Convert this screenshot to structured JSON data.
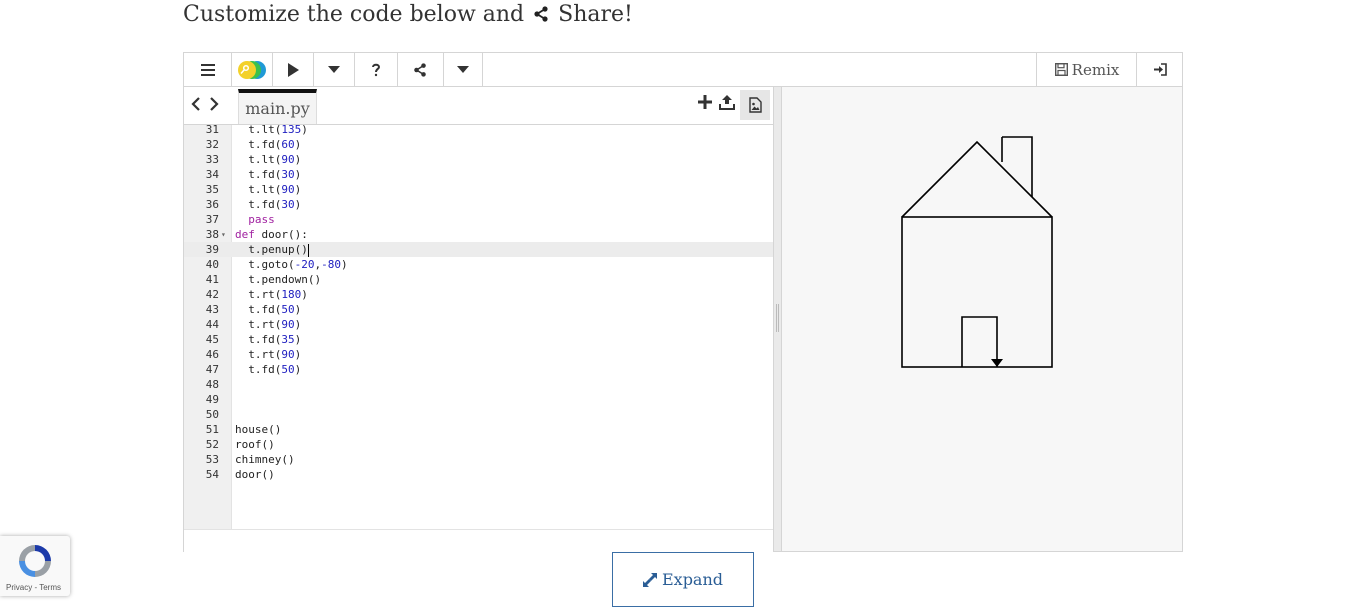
{
  "heading": {
    "prefix": "Customize the code below and",
    "suffix": "Share!"
  },
  "toolbar": {
    "remix_label": "Remix"
  },
  "tabs": [
    {
      "label": "main.py"
    }
  ],
  "code_lines": [
    {
      "n": "31",
      "text": "  t.lt(135)"
    },
    {
      "n": "32",
      "text": "  t.fd(60)"
    },
    {
      "n": "33",
      "text": "  t.lt(90)"
    },
    {
      "n": "34",
      "text": "  t.fd(30)"
    },
    {
      "n": "35",
      "text": "  t.lt(90)"
    },
    {
      "n": "36",
      "text": "  t.fd(30)"
    },
    {
      "n": "37",
      "text": "  pass"
    },
    {
      "n": "38",
      "text": "def door():"
    },
    {
      "n": "39",
      "text": "  t.penup()"
    },
    {
      "n": "40",
      "text": "  t.goto(-20,-80)"
    },
    {
      "n": "41",
      "text": "  t.pendown()"
    },
    {
      "n": "42",
      "text": "  t.rt(180)"
    },
    {
      "n": "43",
      "text": "  t.fd(50)"
    },
    {
      "n": "44",
      "text": "  t.rt(90)"
    },
    {
      "n": "45",
      "text": "  t.fd(35)"
    },
    {
      "n": "46",
      "text": "  t.rt(90)"
    },
    {
      "n": "47",
      "text": "  t.fd(50)"
    },
    {
      "n": "48",
      "text": ""
    },
    {
      "n": "49",
      "text": ""
    },
    {
      "n": "50",
      "text": ""
    },
    {
      "n": "51",
      "text": "house()"
    },
    {
      "n": "52",
      "text": "roof()"
    },
    {
      "n": "53",
      "text": "chimney()"
    },
    {
      "n": "54",
      "text": "door()"
    }
  ],
  "active_line": "39",
  "expand_label": "Expand",
  "recaptcha": {
    "privacy": "Privacy",
    "sep": " - ",
    "terms": "Terms"
  },
  "colors": {
    "accent": "#2a5d95",
    "keyword": "#a020a0",
    "number": "#2020c0"
  }
}
